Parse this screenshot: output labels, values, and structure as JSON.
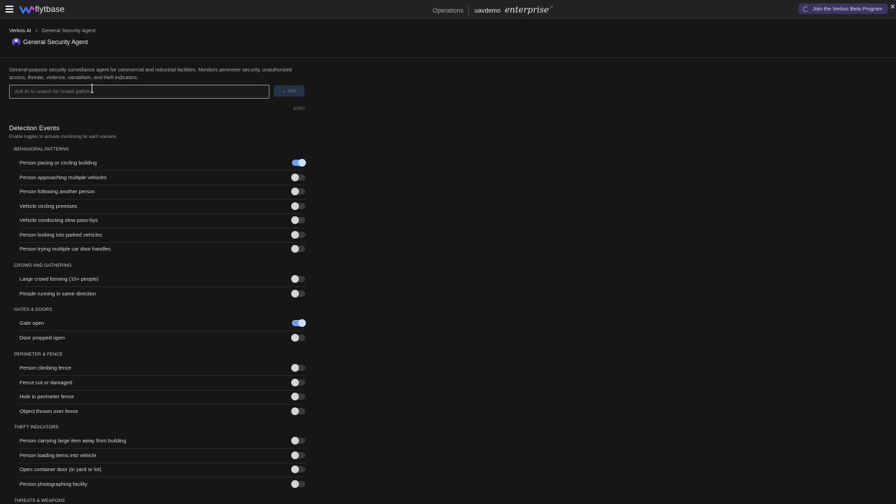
{
  "topbar": {
    "logo_text": "flytbase",
    "nav_operations": "Operations",
    "org_name": "uavdemo",
    "plan": "enterprise",
    "beta_label": "Join the Verkos Beta Program",
    "close_glyph": "✕",
    "icons": {
      "menu": "hamburger-menu-icon",
      "logo": "flytbase-logo",
      "beta": "spinner-icon",
      "close": "close-icon"
    }
  },
  "breadcrumb": {
    "root": "Verkos AI",
    "separator": "›",
    "current": "General Security Agent"
  },
  "agent": {
    "name": "General Security Agent",
    "avatar_color": "#6a4cc8"
  },
  "description": "General-purpose security surveillance agent for commercial and industrial facilities. Monitors perimeter security, unauthorized access, threats, violence, vandalism, and theft indicators.",
  "search": {
    "placeholder": "Ask AI to search for crowd gather",
    "value": "",
    "add_label": "Add",
    "add_icon": "plus-icon",
    "counter": "0/300"
  },
  "detection": {
    "title": "Detection Events",
    "subtitle": "Enable toggles to activate monitoring for each scenario",
    "toggle_on_color": "#6e9ff5",
    "categories": [
      {
        "name": "BEHAVIORAL PATTERNS",
        "items": [
          {
            "label": "Person pacing or circling building",
            "enabled": true
          },
          {
            "label": "Person approaching multiple vehicles",
            "enabled": false
          },
          {
            "label": "Person following another person",
            "enabled": false
          },
          {
            "label": "Vehicle circling premises",
            "enabled": false
          },
          {
            "label": "Vehicle conducting slow pass-bys",
            "enabled": false
          },
          {
            "label": "Person looking into parked vehicles",
            "enabled": false
          },
          {
            "label": "Person trying multiple car door handles",
            "enabled": false
          }
        ]
      },
      {
        "name": "CROWD AND GATHERING",
        "items": [
          {
            "label": "Large crowd forming (10+ people)",
            "enabled": false
          },
          {
            "label": "People running in same direction",
            "enabled": false
          }
        ]
      },
      {
        "name": "GATES & DOORS",
        "items": [
          {
            "label": "Gate open",
            "enabled": true
          },
          {
            "label": "Door propped open",
            "enabled": false
          }
        ]
      },
      {
        "name": "PERIMETER & FENCE",
        "items": [
          {
            "label": "Person climbing fence",
            "enabled": false
          },
          {
            "label": "Fence cut or damaged",
            "enabled": false
          },
          {
            "label": "Hole in perimeter fence",
            "enabled": false
          },
          {
            "label": "Object thrown over fence",
            "enabled": false
          }
        ]
      },
      {
        "name": "THEFT INDICATORS",
        "items": [
          {
            "label": "Person carrying large item away from building",
            "enabled": false
          },
          {
            "label": "Person loading items into vehicle",
            "enabled": false
          },
          {
            "label": "Open container door (in yard or lot)",
            "enabled": false
          },
          {
            "label": "Person photographing facility",
            "enabled": false
          }
        ]
      },
      {
        "name": "THREATS & WEAPONS",
        "items": []
      }
    ]
  }
}
